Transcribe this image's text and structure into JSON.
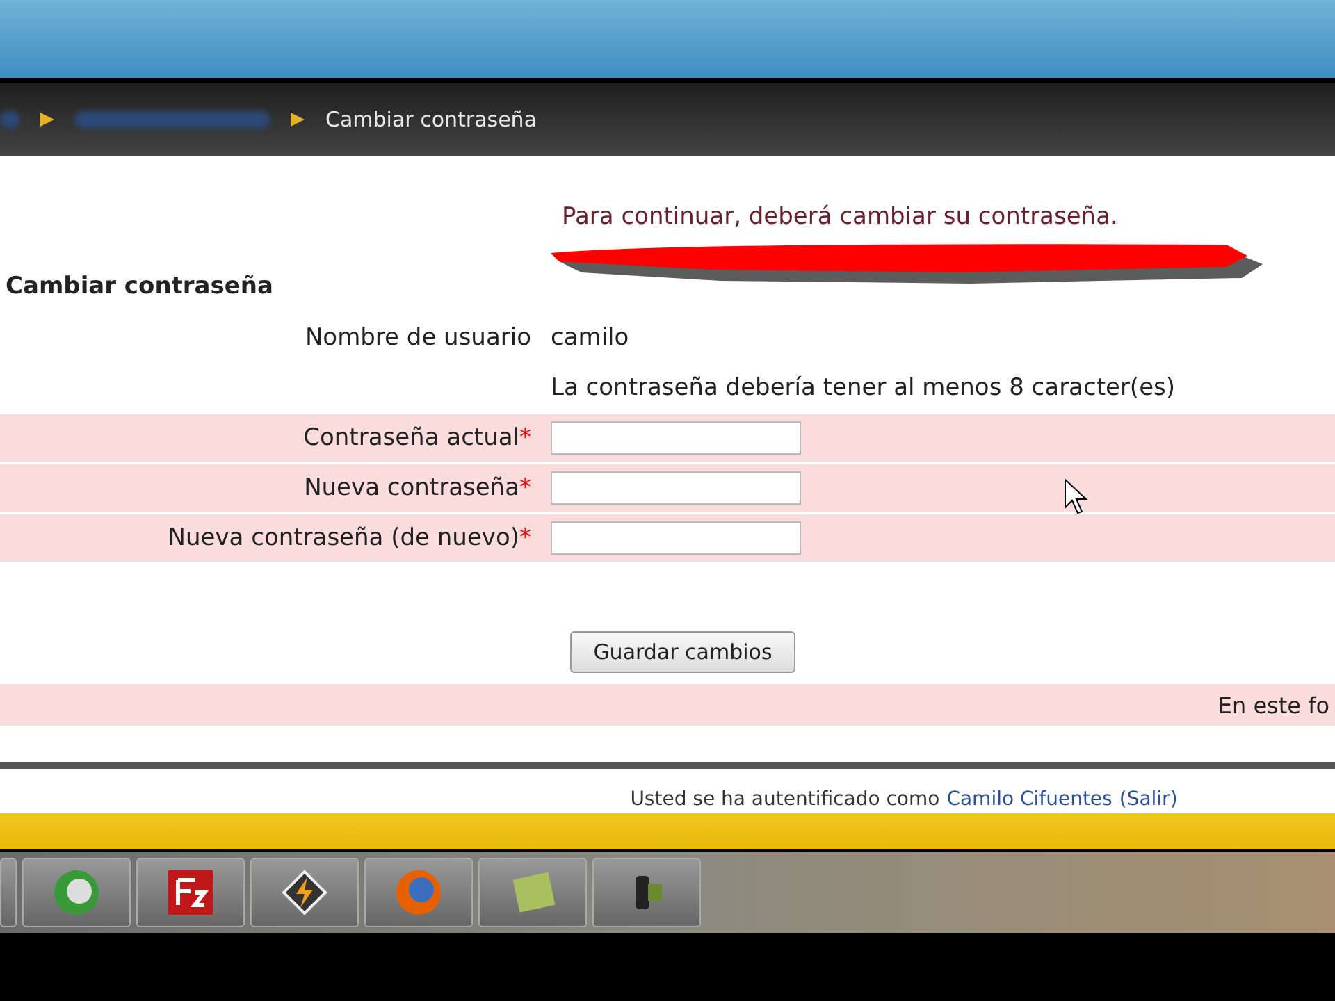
{
  "breadcrumb": {
    "current": "Cambiar contraseña"
  },
  "notice": "Para continuar, deberá cambiar su contraseña.",
  "form": {
    "title": "Cambiar contraseña",
    "username": {
      "label": "Nombre de usuario",
      "value": "camilo"
    },
    "hint": "La contraseña debería tener al menos 8 caracter(es)",
    "fields": [
      {
        "label": "Contraseña actual",
        "required": true,
        "required_mark": "*"
      },
      {
        "label": "Nueva contraseña",
        "required": true,
        "required_mark": "*"
      },
      {
        "label": "Nueva contraseña (de nuevo)",
        "required": true,
        "required_mark": "*"
      }
    ],
    "submit": "Guardar cambios",
    "footer_note": "En este fo"
  },
  "login_info": {
    "text": "Usted se ha autentificado como",
    "user": "Camilo Cifuentes",
    "logout_open": "(",
    "logout": "Salir",
    "logout_close": ")"
  },
  "taskbar": {
    "apps": [
      {
        "kind": "browser-green"
      },
      {
        "kind": "ftp"
      },
      {
        "kind": "player"
      },
      {
        "kind": "firefox"
      },
      {
        "kind": "notes"
      },
      {
        "kind": "camera"
      }
    ]
  }
}
